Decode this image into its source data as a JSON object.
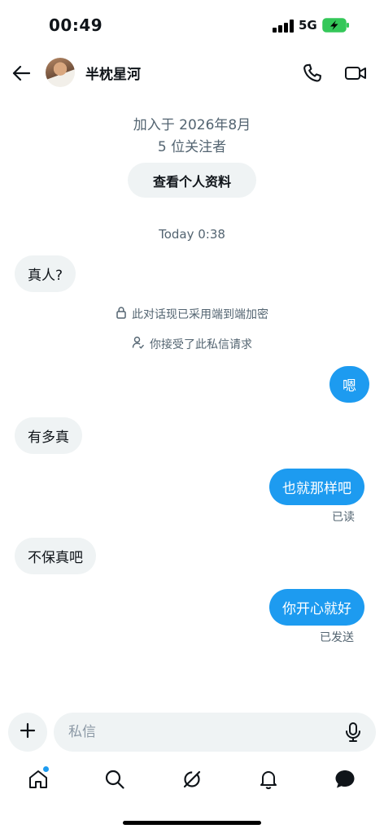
{
  "status_bar": {
    "time": "00:49",
    "network": "5G"
  },
  "header": {
    "contact_name": "半枕星河"
  },
  "profile": {
    "joined": "加入于 2026年8月",
    "followers": "5 位关注者",
    "view_profile_label": "查看个人资料"
  },
  "conversation": {
    "timestamp": "Today 0:38",
    "encryption_notice": "此对话现已采用端到端加密",
    "accepted_notice": "你接受了此私信请求",
    "messages": [
      {
        "text": "真人?",
        "sender": "them"
      },
      {
        "text": "嗯",
        "sender": "me"
      },
      {
        "text": "有多真",
        "sender": "them"
      },
      {
        "text": "也就那样吧",
        "sender": "me",
        "receipt": "已读"
      },
      {
        "text": "不保真吧",
        "sender": "them"
      },
      {
        "text": "你开心就好",
        "sender": "me",
        "receipt": "已发送"
      }
    ]
  },
  "composer": {
    "placeholder": "私信"
  },
  "nav": {
    "items": [
      "home",
      "search",
      "grok",
      "notifications",
      "messages"
    ]
  },
  "colors": {
    "accent": "#1d9bf0",
    "bubble_incoming": "#eff3f4",
    "secondary_text": "#536471"
  },
  "icons": [
    "back-arrow-icon",
    "phone-icon",
    "video-camera-icon",
    "lock-icon",
    "person-check-icon",
    "plus-icon",
    "microphone-icon",
    "home-icon",
    "search-icon",
    "grok-icon",
    "bell-icon",
    "message-icon"
  ]
}
